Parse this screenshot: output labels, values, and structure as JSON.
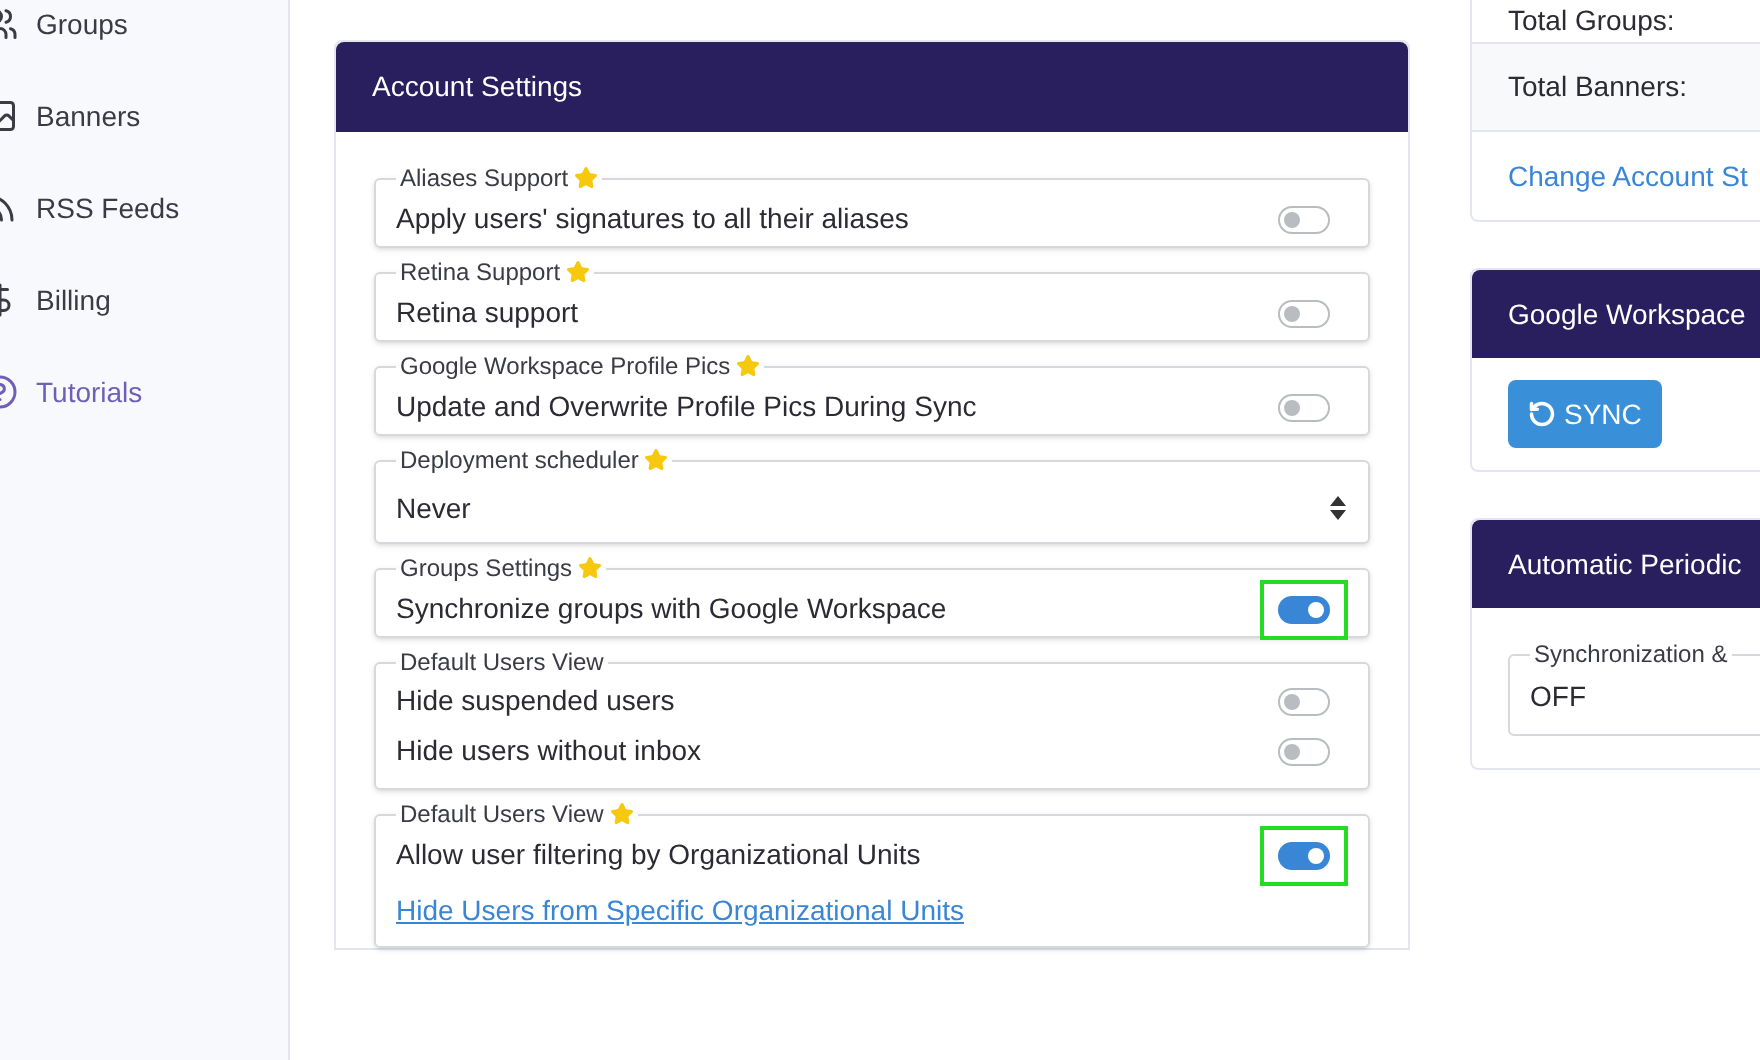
{
  "sidebar": {
    "items": [
      {
        "label": "Groups",
        "selected": false
      },
      {
        "label": "Banners",
        "selected": false
      },
      {
        "label": "RSS Feeds",
        "selected": false
      },
      {
        "label": "Billing",
        "selected": false
      },
      {
        "label": "Tutorials",
        "selected": true
      }
    ]
  },
  "account_settings": {
    "title": "Account Settings",
    "sections": [
      {
        "legend": "Aliases Support",
        "star": true,
        "kind": "toggles",
        "rows": [
          {
            "label": "Apply users' signatures to all their aliases",
            "on": false,
            "highlighted": false
          }
        ]
      },
      {
        "legend": "Retina Support",
        "star": true,
        "kind": "toggles",
        "rows": [
          {
            "label": "Retina support",
            "on": false,
            "highlighted": false
          }
        ]
      },
      {
        "legend": "Google Workspace Profile Pics",
        "star": true,
        "kind": "toggles",
        "rows": [
          {
            "label": "Update and Overwrite Profile Pics During Sync",
            "on": false,
            "highlighted": false
          }
        ]
      },
      {
        "legend": "Deployment scheduler",
        "star": true,
        "kind": "select",
        "value": "Never"
      },
      {
        "legend": "Groups Settings",
        "star": true,
        "kind": "toggles",
        "rows": [
          {
            "label": "Synchronize groups with Google Workspace",
            "on": true,
            "highlighted": true
          }
        ]
      },
      {
        "legend": "Default Users View",
        "star": false,
        "kind": "toggles",
        "rows": [
          {
            "label": "Hide suspended users",
            "on": false,
            "highlighted": false
          },
          {
            "label": "Hide users without inbox",
            "on": false,
            "highlighted": false
          }
        ]
      },
      {
        "legend": "Default Users View",
        "star": true,
        "kind": "toggles",
        "rows": [
          {
            "label": "Allow user filtering by Organizational Units",
            "on": true,
            "highlighted": true
          }
        ],
        "link": "Hide Users from Specific Organizational Units"
      }
    ]
  },
  "account_stats": {
    "rows": [
      "Total Groups:",
      "Total Banners:"
    ],
    "link": "Change Account St"
  },
  "workspace_sync": {
    "title": "Google Workspace",
    "button": "SYNC"
  },
  "periodic_sync": {
    "title": "Automatic Periodic",
    "legend": "Synchronization &",
    "value": "OFF"
  }
}
